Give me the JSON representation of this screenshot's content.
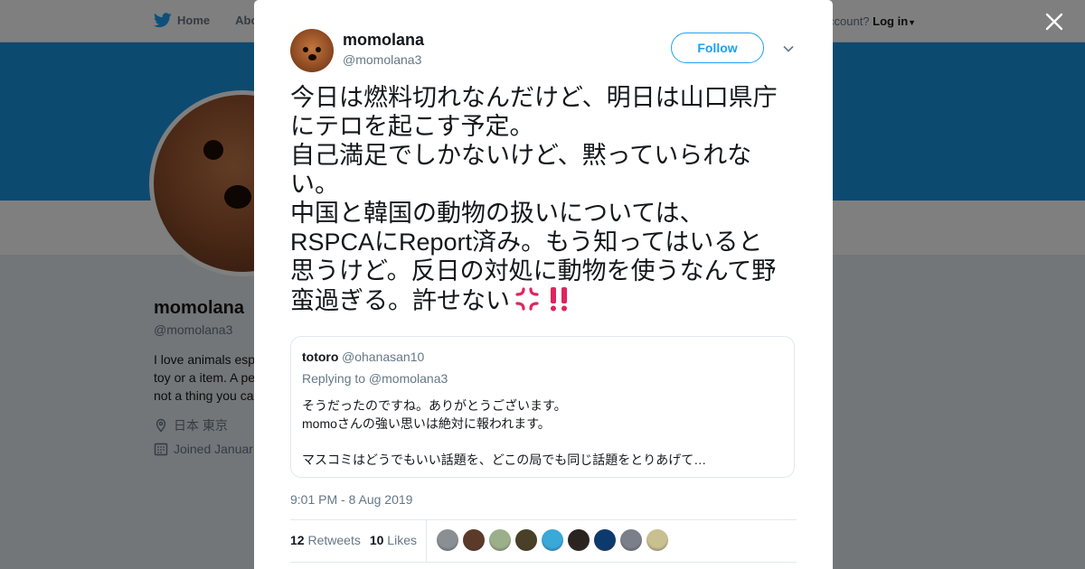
{
  "background_page": {
    "nav": {
      "home_label": "Home",
      "about_label": "Abo"
    },
    "login": {
      "prompt": "ccount?",
      "login_label": "Log in"
    },
    "profile": {
      "name": "momolana",
      "handle": "@momolana3",
      "bio_lines": [
        "I love animals esp",
        "toy or a item. A pe",
        "not a thing you ca"
      ],
      "location": "日本 東京",
      "joined": "Joined Januar"
    }
  },
  "tweet": {
    "author_name": "momolana",
    "author_handle": "@momolana3",
    "follow_label": "Follow",
    "text_lines": [
      "今日は燃料切れなんだけど、明日は山口県庁",
      "にテロを起こす予定。",
      "自己満足でしかないけど、黙っていられな",
      "い。",
      "中国と韓国の動物の扱いについては、",
      "RSPCAにReport済み。もう知ってはいると",
      "思うけど。反日の対処に動物を使うなんて野",
      "蛮過ぎる。許せない"
    ],
    "emoji": [
      "💢",
      "‼️"
    ],
    "quoted": {
      "name": "totoro",
      "handle": "@ohanasan10",
      "replying_to": "Replying to @momolana3",
      "body_lines": [
        "そうだったのですね。ありがとうございます。",
        "momoさんの強い思いは絶対に報われます。",
        "",
        "マスコミはどうでもいい話題を、どこの局でも同じ話題をとりあげて…"
      ]
    },
    "timestamp": "9:01 PM - 8 Aug 2019",
    "retweets_count": "12",
    "retweets_label": "Retweets",
    "likes_count": "10",
    "likes_label": "Likes",
    "liker_avatar_colors": [
      "#8a8f94",
      "#5c3a2a",
      "#9bb08a",
      "#4a4028",
      "#3aa8d8",
      "#2a2320",
      "#0d3a6e",
      "#7a7f8a",
      "#c8c090"
    ]
  },
  "colors": {
    "accent": "#1da1f2",
    "banner": "#1b95e0",
    "emoji_anger": "#e0245e"
  }
}
